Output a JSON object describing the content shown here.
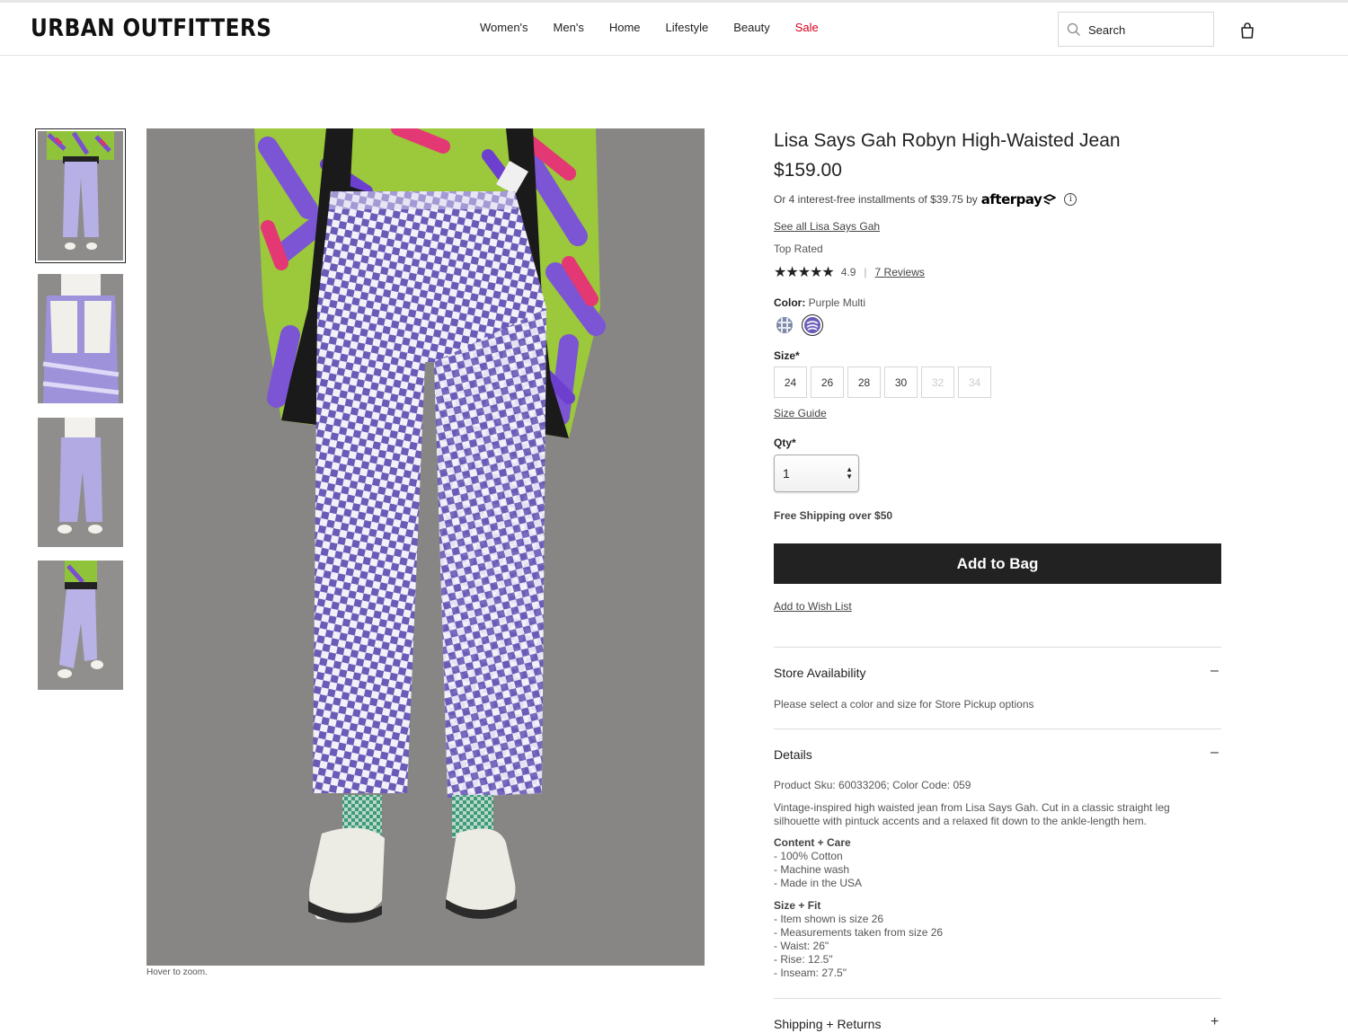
{
  "header": {
    "logo": "URBAN OUTFITTERS",
    "nav": [
      "Women's",
      "Men's",
      "Home",
      "Lifestyle",
      "Beauty",
      "Sale"
    ],
    "search_placeholder": "Search"
  },
  "gallery": {
    "hover_text": "Hover to zoom."
  },
  "product": {
    "title": "Lisa Says Gah Robyn High-Waisted Jean",
    "price": "$159.00",
    "afterpay_text": "Or 4 interest-free installments of $39.75 by",
    "afterpay_logo": "afterpay",
    "brand_link": "See all Lisa Says Gah",
    "top_rated": "Top Rated",
    "stars": "★★★★★",
    "rating": "4.9",
    "reviews_link": "7 Reviews",
    "color_label": "Color:",
    "color_value": "Purple Multi",
    "size_label": "Size*",
    "sizes": [
      {
        "label": "24",
        "available": true
      },
      {
        "label": "26",
        "available": true
      },
      {
        "label": "28",
        "available": true
      },
      {
        "label": "30",
        "available": true
      },
      {
        "label": "32",
        "available": false
      },
      {
        "label": "34",
        "available": false
      }
    ],
    "size_guide": "Size Guide",
    "qty_label": "Qty*",
    "qty_value": "1",
    "shipping_note": "Free Shipping over $50",
    "add_to_bag": "Add to Bag",
    "wish_list": "Add to Wish List"
  },
  "accordions": {
    "store": {
      "title": "Store Availability",
      "toggle": "–",
      "body": "Please select a color and size for Store Pickup options"
    },
    "details": {
      "title": "Details",
      "toggle": "–",
      "sku": "Product Sku: 60033206; Color Code: 059",
      "description": "Vintage-inspired high waisted jean from Lisa Says Gah. Cut in a classic straight leg silhouette with pintuck accents and a relaxed fit down to the ankle-length hem.",
      "care_heading": "Content + Care",
      "care": [
        "- 100% Cotton",
        "- Machine wash",
        "- Made in the USA"
      ],
      "fit_heading": "Size + Fit",
      "fit": [
        "- Item shown is size 26",
        "- Measurements taken from size 26",
        "- Waist: 26\"",
        "- Rise: 12.5\"",
        "- Inseam: 27.5\""
      ]
    },
    "shipping": {
      "title": "Shipping + Returns",
      "toggle": "+"
    }
  },
  "colors": {
    "sale": "#d0021b",
    "button": "#222222",
    "pant_purple": "#6a5bb8"
  }
}
